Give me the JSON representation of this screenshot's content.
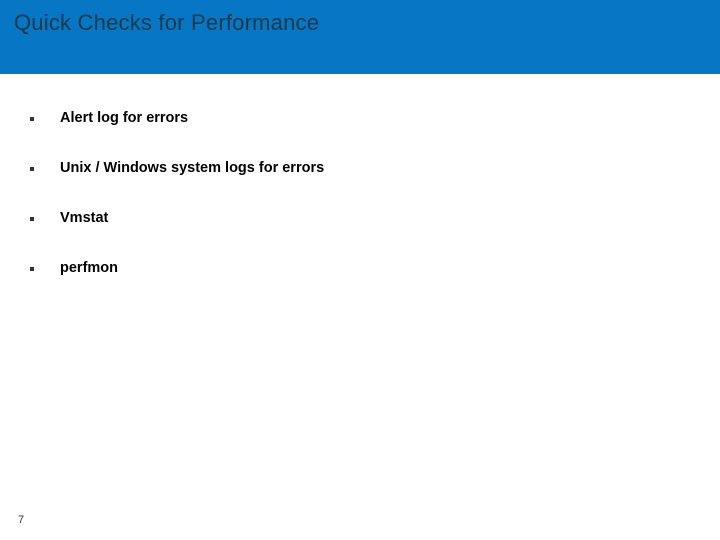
{
  "slide": {
    "title": "Quick Checks for Performance",
    "bullets": [
      "Alert log for errors",
      "Unix / Windows system logs for errors",
      "Vmstat",
      "perfmon"
    ],
    "page_number": "7"
  }
}
